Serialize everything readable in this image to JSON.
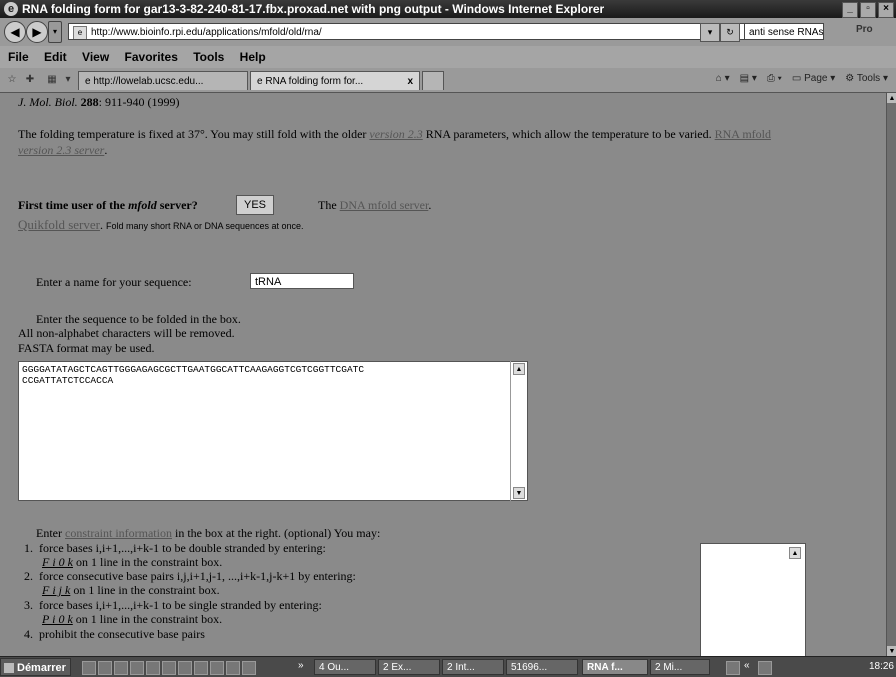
{
  "window": {
    "title": "RNA folding form for gar13-3-82-240-81-17.fbx.proxad.net with png output - Windows Internet Explorer",
    "address": "http://www.bioinfo.rpi.edu/applications/mfold/old/rna/",
    "search_value": "anti sense RNAs",
    "search_brand": "Pro",
    "back_icon": "back-arrow-icon",
    "forward_icon": "forward-arrow-icon"
  },
  "menu": [
    "File",
    "Edit",
    "View",
    "Favorites",
    "Tools",
    "Help"
  ],
  "tabs": [
    {
      "label": "http://lowelab.ucsc.edu..."
    },
    {
      "label": "RNA folding form for...",
      "close": "x"
    }
  ],
  "commands": {
    "page": "Page",
    "tools": "Tools"
  },
  "page": {
    "citation_journal": "J. Mol. Biol.",
    "citation_volume": "288",
    "citation_rest": ": 911-940 (1999)",
    "temp_text_1": "The folding temperature is fixed at 37°. You may still fold with the older",
    "temp_version": "version 2.3",
    "temp_text_2": "RNA parameters, which allow the temperature to be varied.",
    "temp_link_1": "RNA mfold",
    "temp_link_2": "version 2.3 server",
    "first_time_a": "First time user of the",
    "first_time_mfold": "mfold",
    "first_time_b": "server?",
    "yes_button": "YES",
    "dna_the": "The",
    "dna_link": "DNA mfold server",
    "quikfold_link": "Quikfold server",
    "quikfold_desc": "Fold many short RNA or DNA sequences at once.",
    "name_label": "Enter a name for your sequence:",
    "name_value": "tRNA",
    "seq_label": "Enter the sequence to be folded in the box.",
    "seq_note_1": "All non-alphabet characters will be removed.",
    "seq_note_2": "FASTA format may be used.",
    "sequence": "GGGGATATAGCTCAGTTGGGAGAGCGCTTGAATGGCATTCAAGAGGTCGTCGGTTCGATC\nCCGATTATCTCCACCA",
    "constraint_a": "Enter",
    "constraint_link": "constraint information",
    "constraint_b": "in the box at the right. (optional) You may:",
    "items": [
      {
        "num": "1.",
        "text": "force bases i,i+1,...,i+k-1 to be double stranded by entering:",
        "code": "F  i  0  k",
        "code_rest": "on 1 line in the constraint box."
      },
      {
        "num": "2.",
        "text": "force consecutive base pairs i,j,i+1,j-1, ...,i+k-1,j-k+1 by entering:",
        "code": "F  i  j  k",
        "code_rest": "on 1 line in the constraint box."
      },
      {
        "num": "3.",
        "text": "force bases i,i+1,...,i+k-1 to be single stranded by entering:",
        "code": "P  i  0  k",
        "code_rest": "on 1 line in the constraint box."
      },
      {
        "num": "4.",
        "text": "prohibit the consecutive base pairs"
      }
    ]
  },
  "taskbar": {
    "start": "Démarrer",
    "buttons": [
      "4 Ou...",
      "2 Ex...",
      "2 Int...",
      "51696...",
      "RNA f...",
      "2 Mi..."
    ],
    "clock": "18:26"
  }
}
